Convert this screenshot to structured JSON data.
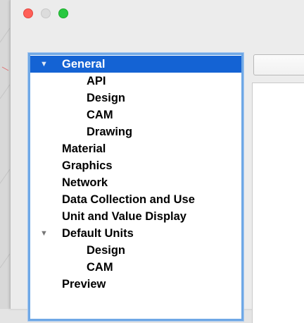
{
  "window": {
    "controls": [
      "close",
      "minimize",
      "zoom"
    ]
  },
  "tree": {
    "items": [
      {
        "label": "General",
        "level": 0,
        "expanded": true,
        "selected": true,
        "has_arrow": true
      },
      {
        "label": "API",
        "level": 1
      },
      {
        "label": "Design",
        "level": 1
      },
      {
        "label": "CAM",
        "level": 1
      },
      {
        "label": "Drawing",
        "level": 1
      },
      {
        "label": "Material",
        "level": 0
      },
      {
        "label": "Graphics",
        "level": 0
      },
      {
        "label": "Network",
        "level": 0
      },
      {
        "label": "Data Collection and Use",
        "level": 0
      },
      {
        "label": "Unit and Value Display",
        "level": 0
      },
      {
        "label": "Default Units",
        "level": 0,
        "expanded": true,
        "has_arrow": true
      },
      {
        "label": "Design",
        "level": 1
      },
      {
        "label": "CAM",
        "level": 1
      },
      {
        "label": "Preview",
        "level": 0
      }
    ]
  },
  "icons": {
    "expanded": "disclosure-triangle-down-icon"
  },
  "colors": {
    "selection": "#1463d4",
    "focus_ring": "#6fa8e6",
    "close": "#ff5f57",
    "zoom": "#28c840"
  }
}
